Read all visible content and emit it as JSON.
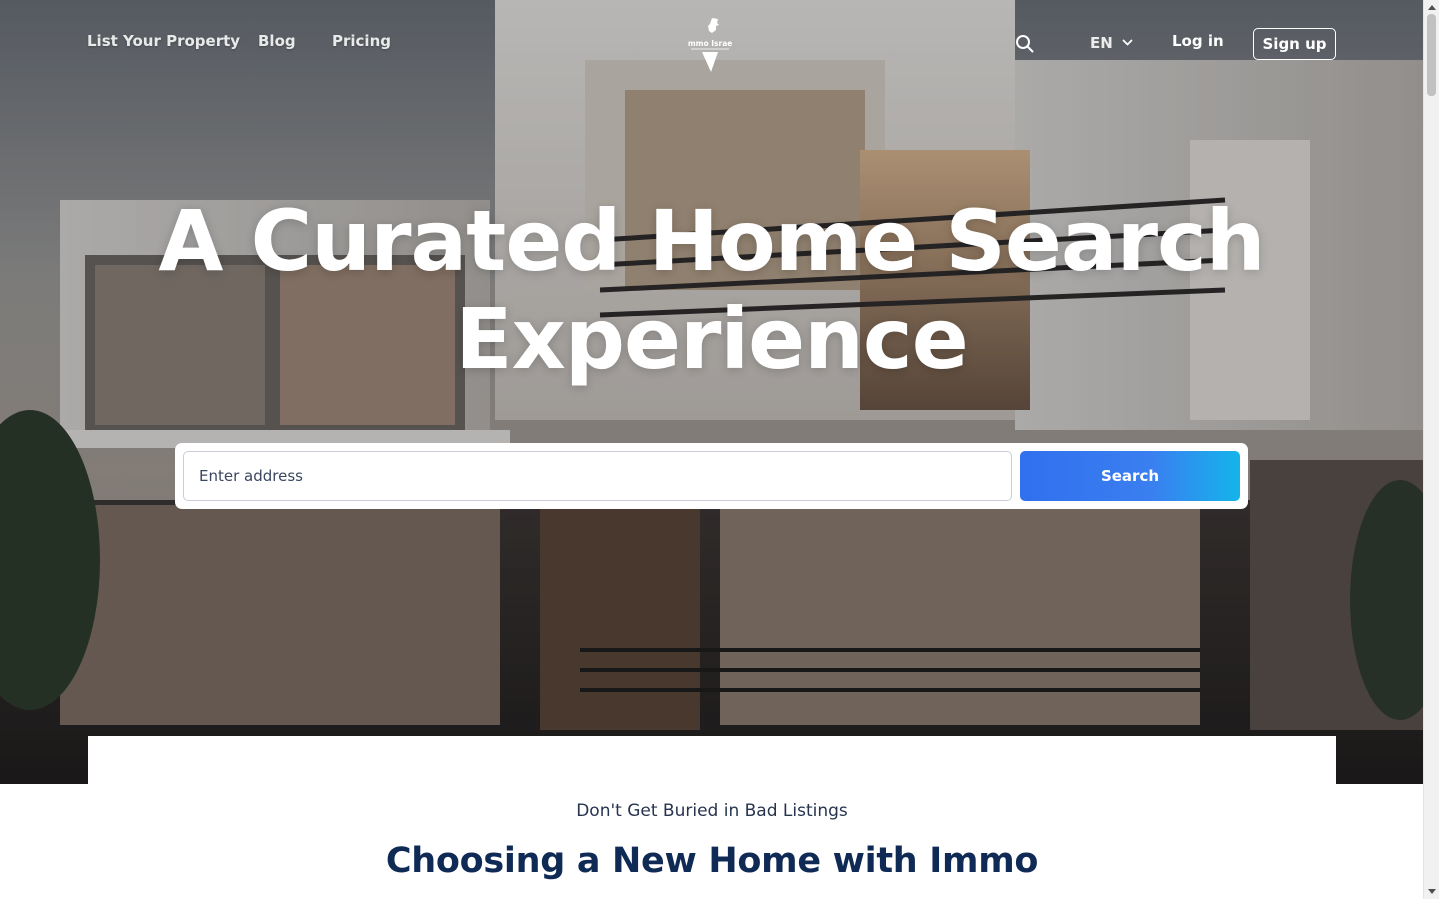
{
  "nav": {
    "links": [
      {
        "label": "List Your Property"
      },
      {
        "label": "Blog"
      },
      {
        "label": "Pricing"
      }
    ],
    "logo_text": "Immo Israel",
    "language": "EN",
    "login_label": "Log in",
    "signup_label": "Sign up"
  },
  "hero": {
    "headline_line1": "A Curated Home Search",
    "headline_line2": "Experience"
  },
  "search": {
    "placeholder": "Enter address",
    "button_label": "Search"
  },
  "section": {
    "eyebrow": "Don't Get Buried in Bad Listings",
    "title": "Choosing a New Home with Immo"
  },
  "colors": {
    "navy": "#0f2a55",
    "button_start": "#3170ee",
    "button_end": "#14b4ea"
  },
  "icons": {
    "search": "magnifier-icon",
    "language": "chevron-down-icon"
  }
}
